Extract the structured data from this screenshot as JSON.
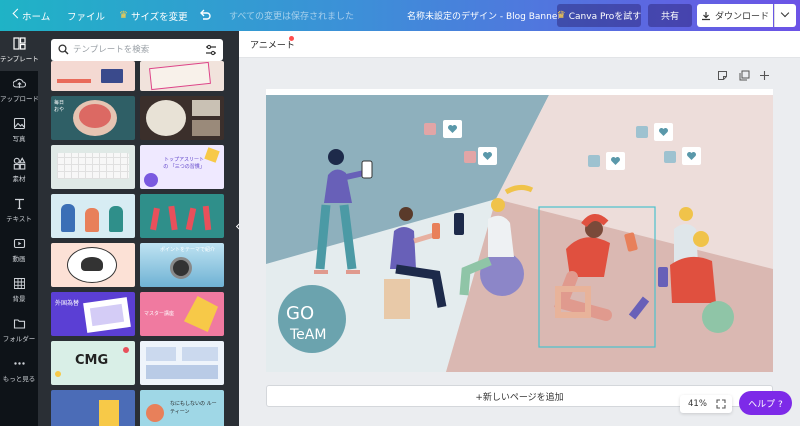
{
  "topbar": {
    "home_label": "ホーム",
    "file_label": "ファイル",
    "resize_label": "サイズを変更",
    "saved_status": "すべての変更は保存されました",
    "document_title": "名称未設定のデザイン - Blog Banner",
    "pro_button_label": "Canva Proを試す",
    "share_button_label": "共有",
    "download_button_label": "ダウンロード"
  },
  "rail": {
    "items": [
      {
        "label": "テンプレート",
        "icon": "template-icon"
      },
      {
        "label": "アップロード",
        "icon": "upload-icon"
      },
      {
        "label": "写真",
        "icon": "photo-icon"
      },
      {
        "label": "素材",
        "icon": "elements-icon"
      },
      {
        "label": "テキスト",
        "icon": "text-icon"
      },
      {
        "label": "動画",
        "icon": "video-icon"
      },
      {
        "label": "背景",
        "icon": "background-icon"
      },
      {
        "label": "フォルダー",
        "icon": "folder-icon"
      },
      {
        "label": "もっと見る",
        "icon": "more-icon"
      }
    ]
  },
  "panel": {
    "search_placeholder": "テンプレートを検索",
    "thumbnails": [
      {
        "text": "",
        "bg": "#f4d9d2"
      },
      {
        "text": "",
        "bg": "#f1e3dc"
      },
      {
        "text": "毎日 おや",
        "bg": "#2f5f66"
      },
      {
        "text": "",
        "bg": "#3b2f2b"
      },
      {
        "text": "",
        "bg": "#dfe9e6"
      },
      {
        "text": "トップアスリートの 「三つの習慣」",
        "bg": "#efe9ff"
      },
      {
        "text": "",
        "bg": "#d7ecf3"
      },
      {
        "text": "",
        "bg": "#2f8f8a"
      },
      {
        "text": "",
        "bg": "#fce1d6"
      },
      {
        "text": "ポイントをテーマで紹介",
        "bg": "#9fd0e6"
      },
      {
        "text": "外国為替",
        "bg": "#5b3fd4"
      },
      {
        "text": "マスター講座",
        "bg": "#f07aa0"
      },
      {
        "text": "CMG",
        "bg": "#d9efe7"
      },
      {
        "text": "",
        "bg": "#eef4fb"
      },
      {
        "text": "",
        "bg": "#4b6cb7"
      },
      {
        "text": "なにもしないの ルーティーン",
        "bg": "#9fd7e6"
      }
    ]
  },
  "workspace": {
    "tab_label": "アニメート",
    "add_page_label": "+新しいページを追加",
    "zoom_level": "41%",
    "help_label": "ヘルプ ?"
  },
  "design": {
    "logo_text_line1": "GO",
    "logo_text_line2": "TeAM",
    "colors": {
      "blue_panel": "#8eb0bd",
      "pink_panel": "#edddda",
      "mint_panel": "#dbe7e8",
      "rose_panel": "#d7b4ad",
      "accent_red": "#e0503f",
      "accent_purple": "#6860b8",
      "selection": "#4cc2cc"
    }
  }
}
